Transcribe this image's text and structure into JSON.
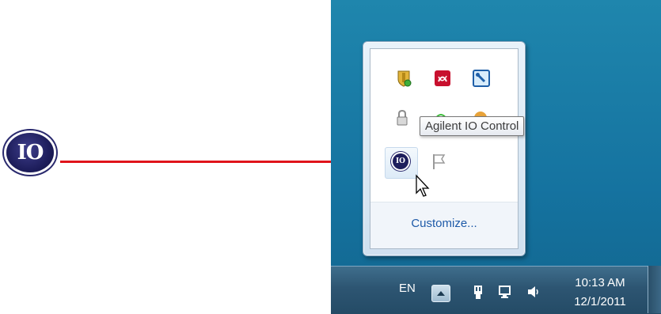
{
  "callout": {
    "icon_text": "IO"
  },
  "tooltip": {
    "text": "Agilent IO Control"
  },
  "popup": {
    "customize_label": "Customize...",
    "selected_icon_text": "IO"
  },
  "taskbar": {
    "language": "EN",
    "time": "10:13 AM",
    "date": "12/1/2011"
  },
  "colors": {
    "desktop": "#1a7aa0",
    "arrow": "#e0141b",
    "link": "#1e5aa8"
  }
}
